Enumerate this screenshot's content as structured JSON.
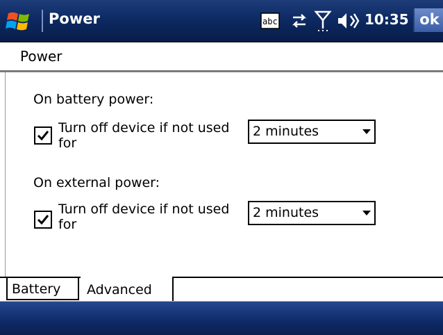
{
  "titlebar": {
    "app_title": "Power",
    "clock": "10:35",
    "ok_label": "ok",
    "icons": [
      "windows-start-icon",
      "abc-input-icon",
      "connectivity-icon",
      "signal-icon",
      "speaker-icon"
    ]
  },
  "header": {
    "title": "Power"
  },
  "battery": {
    "label": "On battery power:",
    "checkbox_label": "Turn off device if not used for",
    "checked": true,
    "dropdown_value": "2 minutes"
  },
  "external": {
    "label": "On external power:",
    "checkbox_label": "Turn off device if not used for",
    "checked": true,
    "dropdown_value": "2 minutes"
  },
  "tabs": [
    {
      "label": "Battery",
      "active": false
    },
    {
      "label": "Advanced",
      "active": true
    }
  ],
  "colors": {
    "titlebar": "#0d2a63",
    "ok_button": "#4a6db5"
  }
}
